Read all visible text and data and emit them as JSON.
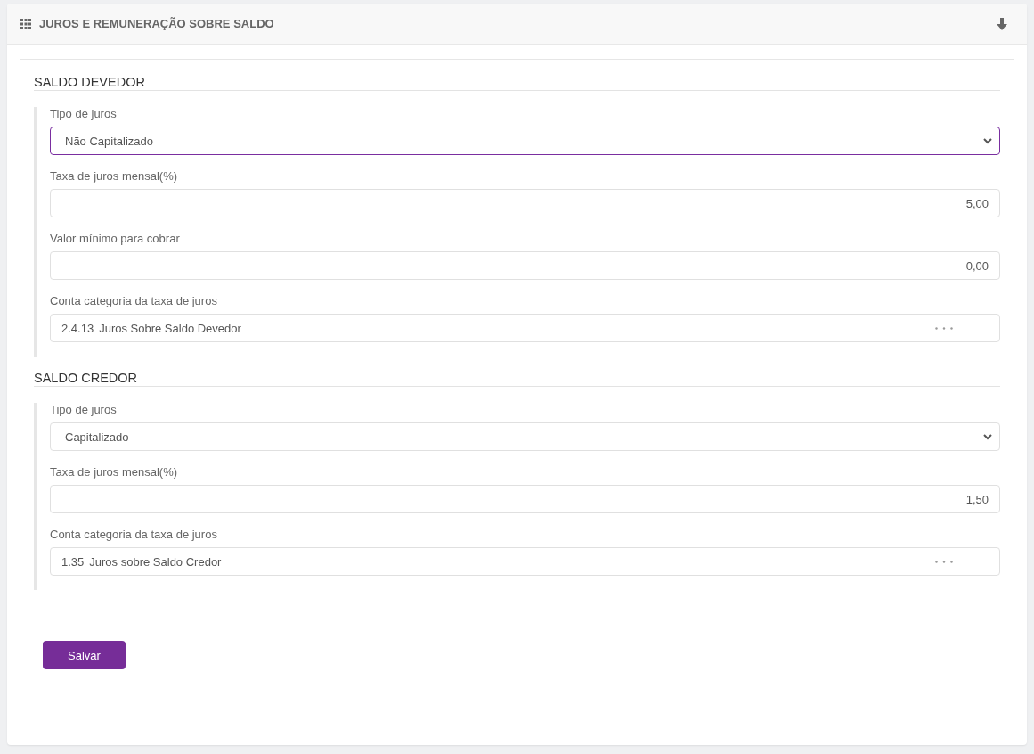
{
  "panel": {
    "title": "JUROS E REMUNERAÇÃO SOBRE SALDO"
  },
  "sections": [
    {
      "title": "SALDO DEVEDOR",
      "fields": [
        {
          "kind": "select",
          "label": "Tipo de juros",
          "value": "Não Capitalizado",
          "focused": true
        },
        {
          "kind": "number",
          "label": "Taxa de juros mensal(%)",
          "value": "5,00",
          "focused": false
        },
        {
          "kind": "number",
          "label": "Valor mínimo para cobrar",
          "value": "0,00",
          "focused": false
        },
        {
          "kind": "lookup",
          "label": "Conta categoria da taxa de juros",
          "code": "2.4.13",
          "value": "Juros Sobre Saldo Devedor",
          "focused": false
        }
      ]
    },
    {
      "title": "SALDO CREDOR",
      "fields": [
        {
          "kind": "select",
          "label": "Tipo de juros",
          "value": "Capitalizado",
          "focused": false
        },
        {
          "kind": "number",
          "label": "Taxa de juros mensal(%)",
          "value": "1,50",
          "focused": false
        },
        {
          "kind": "lookup",
          "label": "Conta categoria da taxa de juros",
          "code": "1.35",
          "value": "Juros sobre Saldo Credor",
          "focused": false
        }
      ]
    }
  ],
  "buttons": [
    {
      "label": "Salvar"
    }
  ]
}
